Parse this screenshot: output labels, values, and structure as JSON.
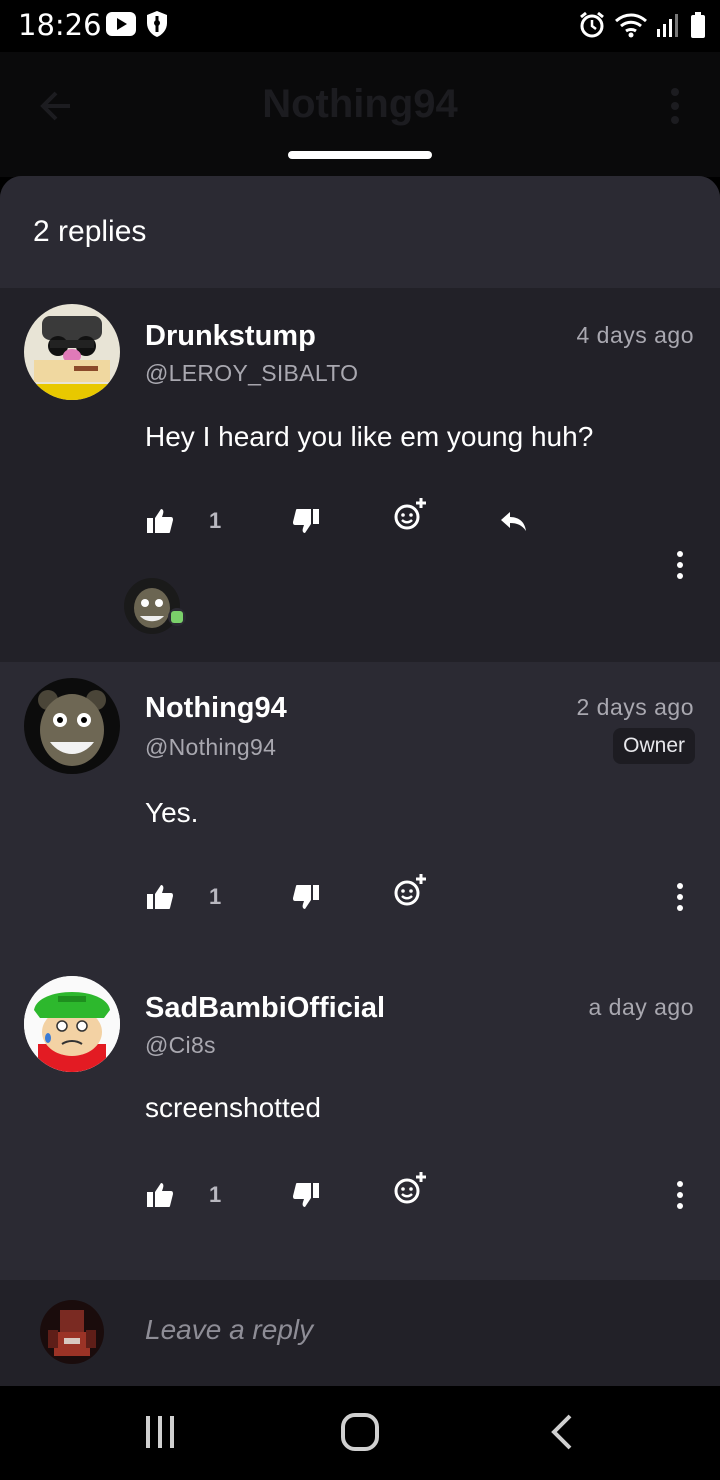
{
  "status_bar": {
    "time": "18:26",
    "icons": [
      "youtube-icon",
      "shield-icon",
      "alarm-icon",
      "wifi-icon",
      "signal-icon",
      "battery-icon"
    ]
  },
  "header": {
    "title": "Nothing94",
    "back_icon": "arrow-left-icon",
    "menu_icon": "more-vertical-icon"
  },
  "sheet": {
    "title": "2 replies"
  },
  "parent_comment": {
    "name": "Drunkstump",
    "handle": "@LEROY_SIBALTO",
    "time": "4 days ago",
    "text": "Hey I heard you like em young huh?",
    "like_count": "1"
  },
  "replies": [
    {
      "name": "Nothing94",
      "handle": "@Nothing94",
      "time": "2 days ago",
      "badge": "Owner",
      "text": "Yes.",
      "like_count": "1"
    },
    {
      "name": "SadBambiOfficial",
      "handle": "@Ci8s",
      "time": "a day ago",
      "text": "screenshotted",
      "like_count": "1"
    }
  ],
  "composer": {
    "placeholder": "Leave a reply"
  },
  "colors": {
    "sheet_bg": "#2b2a33",
    "parent_bg": "#222128",
    "muted_text": "#a9a8b0",
    "online_green": "#7ad06a"
  }
}
